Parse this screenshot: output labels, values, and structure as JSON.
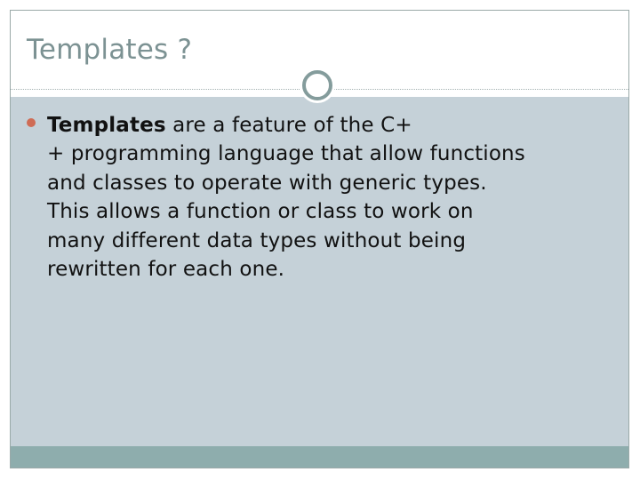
{
  "slide": {
    "title": "Templates ?",
    "bullets": [
      {
        "lead": "Templates",
        "line1": " are a feature of the C+",
        "line2": "+ programming language that allow functions",
        "line3": "and classes to operate with generic types.",
        "line4": "This allows a function or class to work on",
        "line5": "many different data types without being",
        "line6": "rewritten for each one."
      }
    ]
  },
  "colors": {
    "title": "#7c9293",
    "content_background": "#c5d1d8",
    "footer_bar": "#8eadad",
    "bullet": "#cf6c55",
    "ornament_ring": "#849c9c"
  }
}
